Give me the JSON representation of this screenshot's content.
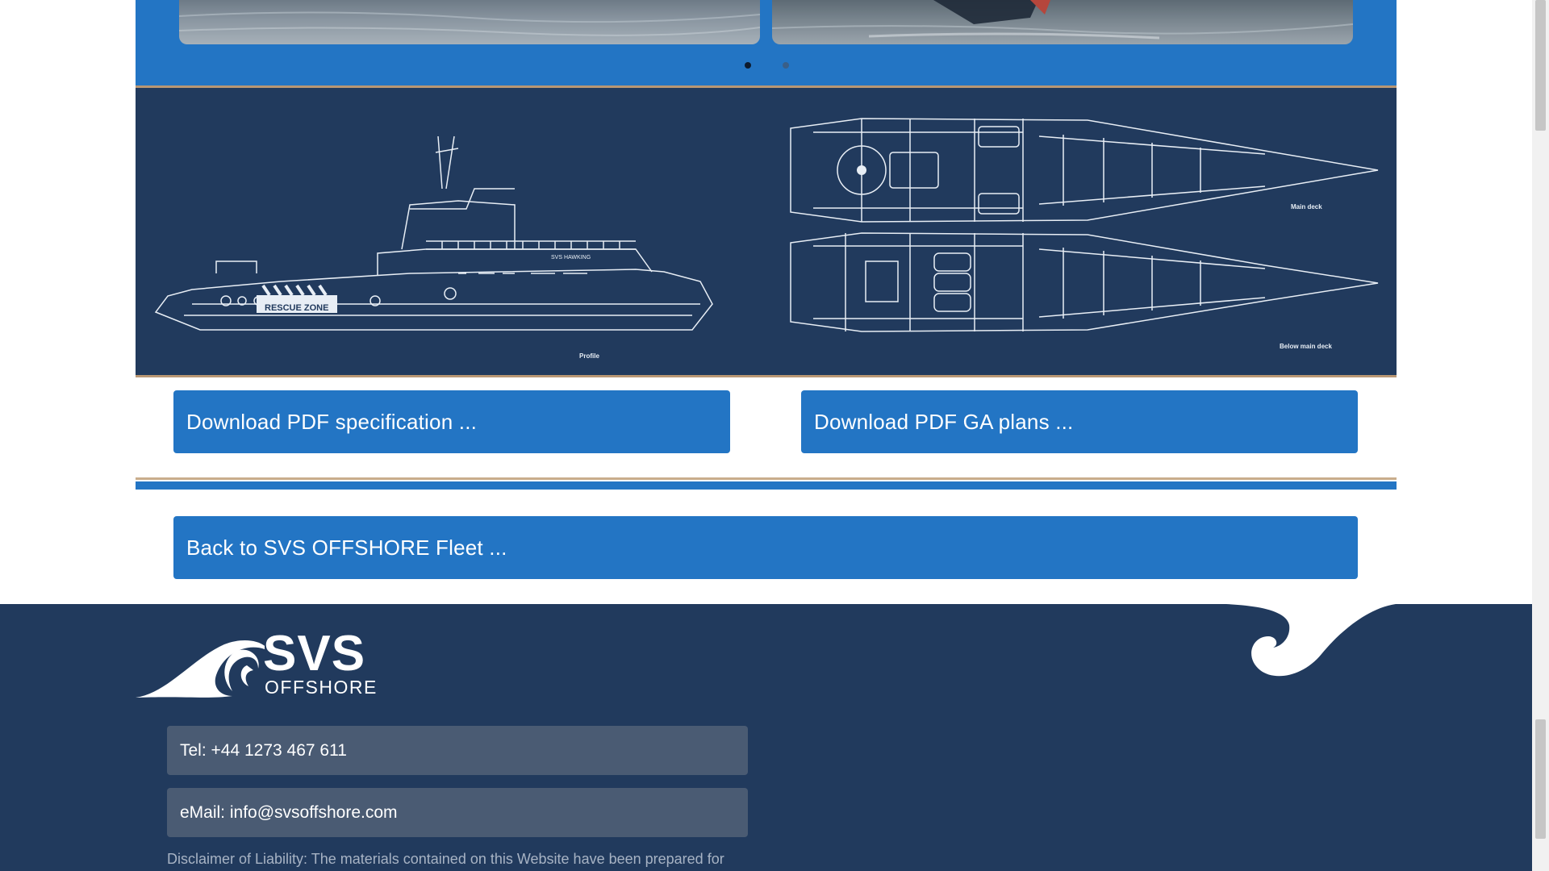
{
  "carousel": {
    "slides": [
      "slide-1",
      "slide-2"
    ],
    "dots": [
      "dot-1",
      "dot-2"
    ]
  },
  "plans": {
    "profile_label": "Profile",
    "rescue_label": "RESCUE ZONE",
    "vessel_name": "SVS HAWKING",
    "main_deck_label": "Main deck",
    "below_deck_label": "Below main deck"
  },
  "buttons": {
    "spec": "Download PDF specification ...",
    "ga": "Download PDF GA plans ...",
    "back": "Back to SVS OFFSHORE Fleet ..."
  },
  "footer": {
    "logo_main": "SVS",
    "logo_sub": "OFFSHORE",
    "tel": "Tel: +44 1273 467 611",
    "email": "eMail: info@svsoffshore.com",
    "disclaimer": "Disclaimer of Liability: The materials contained on this Website have been prepared for"
  },
  "colors": {
    "primary_blue": "#2375c4",
    "navy": "#213a5d",
    "accent_tan": "#b99774"
  }
}
